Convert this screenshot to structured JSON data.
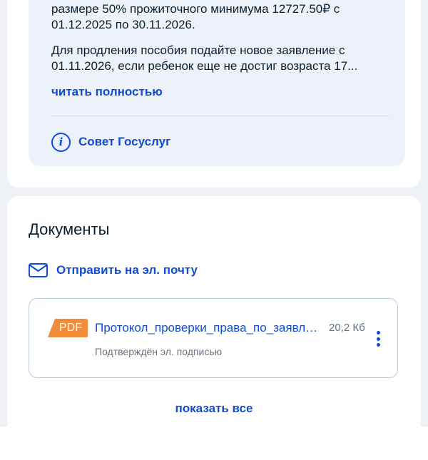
{
  "notice": {
    "paragraph1": [
      "размере 50% прожиточного минимума 12727.50₽ с",
      "01.12.2025 по 30.11.2026."
    ],
    "paragraph2": [
      "Для продления пособия подайте новое заявление с",
      "01.11.2026, если ребенок еще не достиг возраста 17..."
    ],
    "read_more": "читать полностью",
    "tip_icon_glyph": "i",
    "tip_label": "Совет Госуслуг"
  },
  "documents": {
    "title": "Документы",
    "email_icon": "envelope-icon",
    "email_label": "Отправить на эл. почту",
    "file": {
      "badge": "PDF",
      "badge_color": "#f28c38",
      "name": "Протокол_проверки_права_по_заявлению",
      "size": "20,2 Кб",
      "signature": "Подтверждён эл. подписью",
      "menu_icon": "kebab-menu-icon"
    },
    "show_all": "показать все"
  },
  "colors": {
    "accent": "#0d4cd3",
    "background": "#eef2f7",
    "info_box": "#edf2fa",
    "text": "#0b1f33",
    "muted": "#66727f"
  }
}
